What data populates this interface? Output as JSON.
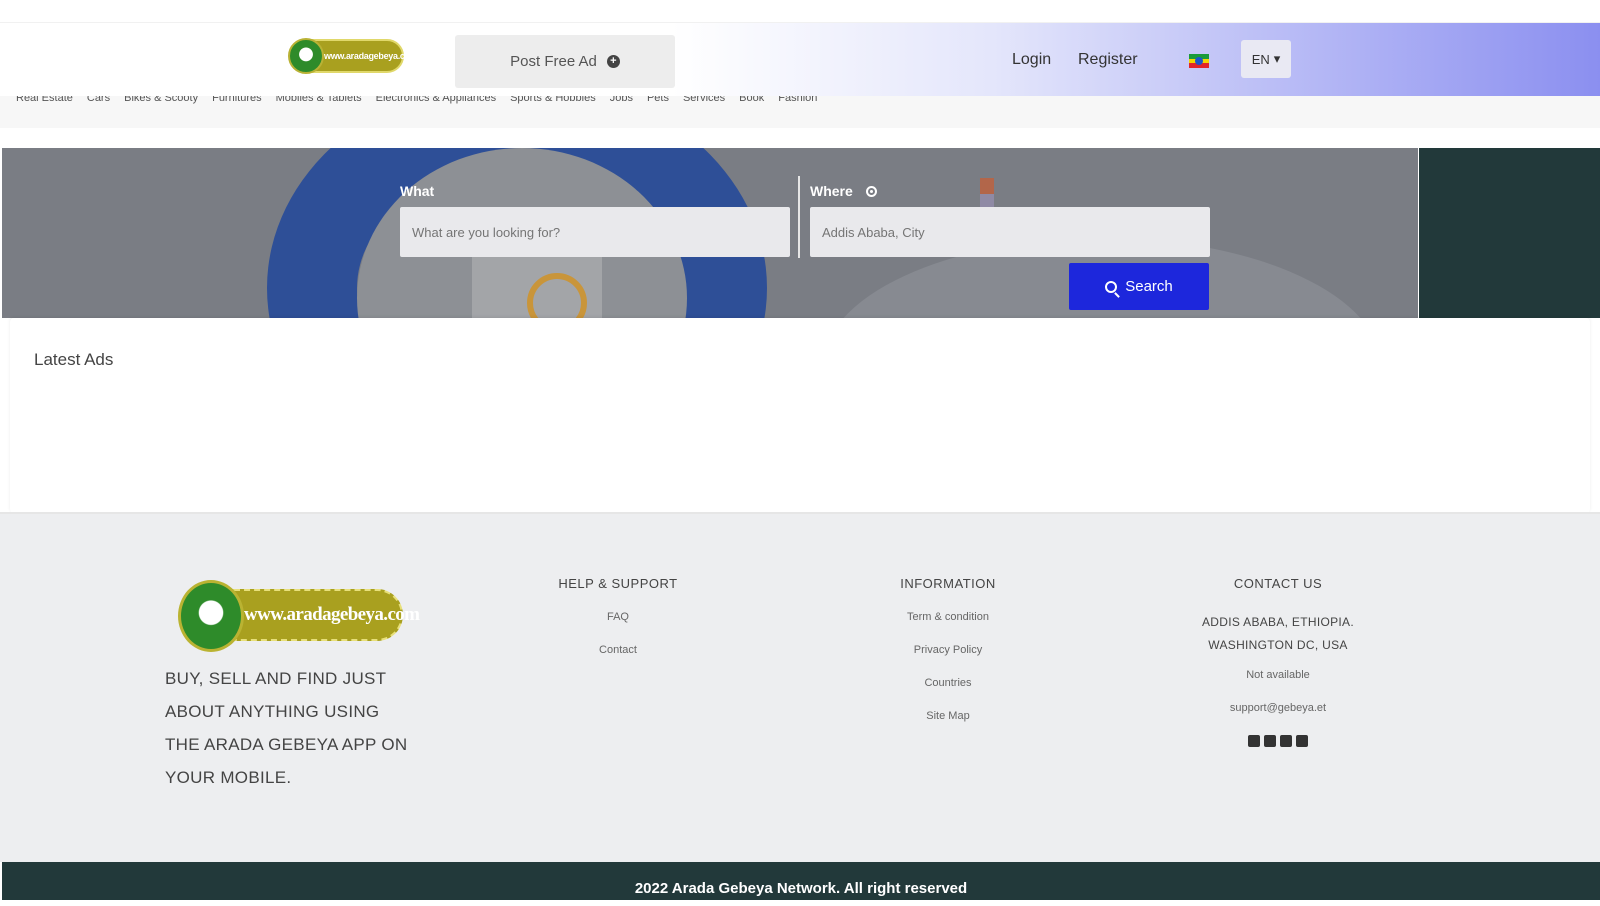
{
  "header": {
    "logo_text": "www.aradagebeya.com",
    "post_ad_label": "Post Free Ad",
    "login_label": "Login",
    "register_label": "Register",
    "language": "EN"
  },
  "categories": [
    "Real Estate",
    "Cars",
    "Bikes & Scooty",
    "Furnitures",
    "Mobiles & Tablets",
    "Electronics & Appliances",
    "Sports & Hobbies",
    "Jobs",
    "Pets",
    "Services",
    "Book",
    "Fashion"
  ],
  "search": {
    "what_label": "What",
    "what_placeholder": "What are you looking for?",
    "where_label": "Where",
    "where_placeholder": "Addis Ababa, City",
    "button_label": "Search"
  },
  "latest": {
    "title": "Latest Ads"
  },
  "footer": {
    "logo_text": "www.aradagebeya.com",
    "tagline": "BUY, SELL AND FIND JUST ABOUT ANYTHING USING THE ARADA GEBEYA APP ON YOUR MOBILE.",
    "help": {
      "title": "HELP & SUPPORT",
      "links": [
        "FAQ",
        "Contact"
      ]
    },
    "info": {
      "title": "INFORMATION",
      "links": [
        "Term & condition",
        "Privacy Policy",
        "Countries",
        "Site Map"
      ]
    },
    "contact": {
      "title": "CONTACT US",
      "address_line1": "ADDIS ABABA, ETHIOPIA.",
      "address_line2": "WASHINGTON DC, USA",
      "phone": "Not available",
      "email": "support@gebeya.et"
    },
    "copyright": "2022 Arada Gebeya Network. All right reserved"
  },
  "colors": {
    "search_button": "#1d27dc",
    "dark_teal": "#22393a",
    "logo_olive": "#a9a01f"
  }
}
